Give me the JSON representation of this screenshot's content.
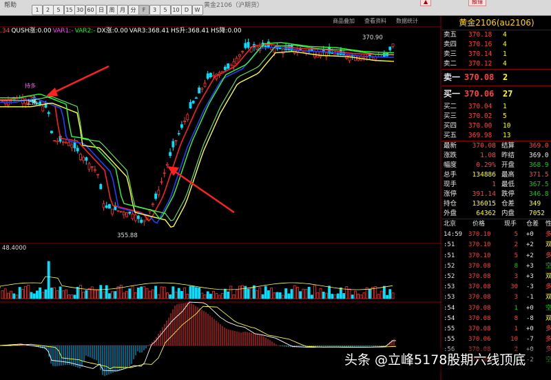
{
  "toolbar": {
    "menu_left": "帮助",
    "title_center": "黄金2106（沪期货）",
    "warn_right": "报错",
    "buttons": [
      "1",
      "2",
      "5",
      "15",
      "30",
      "60",
      "日",
      "周",
      "月",
      "分",
      "F",
      "3",
      "5",
      "10",
      "D",
      "W"
    ]
  },
  "chart": {
    "indicator_line": [
      {
        "text": ".34",
        "color": "#ff4040"
      },
      {
        "text": "QUSH涨:0.00",
        "color": "#ffffff"
      },
      {
        "text": "VAR1:-",
        "color": "#ff40ff"
      },
      {
        "text": "VAR2:-",
        "color": "#00ff00"
      },
      {
        "text": "DX涨:0.00",
        "color": "#ffffff"
      },
      {
        "text": "VAR3:368.41",
        "color": "#ffffff"
      },
      {
        "text": "HS升:368.41",
        "color": "#ffffff"
      },
      {
        "text": "HS降:0.00",
        "color": "#ffffff"
      }
    ],
    "ribbon_labels": [
      "商品叠加",
      "查看资料",
      "数据统计"
    ],
    "high_label": "370.90",
    "low_label": "355.88",
    "signal_up": "上扬",
    "signal_note": "持多",
    "volume_label": "48.4000",
    "chart_data": {
      "type": "candlestick",
      "high": 370.9,
      "low": 355.88,
      "volume_max": 48.4
    }
  },
  "quote": {
    "title": "黄金2106(au2106)",
    "asks": [
      {
        "label": "卖五",
        "price": "370.18",
        "vol": "4"
      },
      {
        "label": "卖四",
        "price": "370.16",
        "vol": "4"
      },
      {
        "label": "卖三",
        "price": "370.14",
        "vol": "1"
      },
      {
        "label": "卖二",
        "price": "370.12",
        "vol": "4"
      }
    ],
    "ask1": {
      "label": "卖一",
      "price": "370.08",
      "vol": "2"
    },
    "bid1": {
      "label": "买一",
      "price": "370.06",
      "vol": "27"
    },
    "bids": [
      {
        "label": "买二",
        "price": "370.04",
        "vol": "1"
      },
      {
        "label": "买三",
        "price": "370.02",
        "vol": "5"
      },
      {
        "label": "买四",
        "price": "370.00",
        "vol": "10"
      },
      {
        "label": "买五",
        "price": "369.98",
        "vol": "13"
      }
    ],
    "stats": [
      {
        "l1": "最新",
        "v1": "370.08",
        "l2": "结算",
        "v2": "369.0"
      },
      {
        "l1": "涨跌",
        "v1": "1.08",
        "l2": "昨结",
        "v2": "369.0"
      },
      {
        "l1": "幅度",
        "v1": "0.29%",
        "l2": "开盘",
        "v2": "368.9"
      },
      {
        "l1": "总手",
        "v1": "134886",
        "l2": "最高",
        "v2": "371.5"
      },
      {
        "l1": "现手",
        "v1": "1",
        "l2": "最低",
        "v2": "367.5"
      },
      {
        "l1": "涨停",
        "v1": "391.14",
        "l2": "跌停",
        "v2": "346.8"
      },
      {
        "l1": "持仓",
        "v1": "136015",
        "l2": "仓差",
        "v2": "349"
      },
      {
        "l1": "外盘",
        "v1": "64362",
        "l2": "内盘",
        "v2": "7052"
      }
    ],
    "tick_header": {
      "time": "北京",
      "price": "价格",
      "vol": "现手",
      "oi": "仓差",
      "kind": "性"
    },
    "ticks": [
      {
        "time": "14:59",
        "price": "370.10",
        "vol": "5",
        "oi": "+0",
        "kind": "多"
      },
      {
        "time": ":51",
        "price": "370.10",
        "vol": "2",
        "oi": "+2",
        "kind": "双"
      },
      {
        "time": ":51",
        "price": "370.10",
        "vol": "5",
        "oi": "+2",
        "kind": "多"
      },
      {
        "time": ":52",
        "price": "370.08",
        "vol": "8",
        "oi": "+3",
        "kind": "空"
      },
      {
        "time": ":52",
        "price": "370.08",
        "vol": "3",
        "oi": "+3",
        "kind": "双"
      },
      {
        "time": ":53",
        "price": "370.08",
        "vol": "30",
        "oi": "-3",
        "kind": "多"
      },
      {
        "time": ":53",
        "price": "370.08",
        "vol": "3",
        "oi": "-1",
        "kind": "双"
      },
      {
        "time": ":54",
        "price": "370.08",
        "vol": "1",
        "oi": "+0",
        "kind": "空"
      },
      {
        "time": ":54",
        "price": "370.08",
        "vol": "8",
        "oi": "-8",
        "kind": "双"
      },
      {
        "time": ":55",
        "price": "370.08",
        "vol": "1",
        "oi": "+0",
        "kind": "多"
      },
      {
        "time": ":55",
        "price": "370.06",
        "vol": "10",
        "oi": "-7",
        "kind": "多"
      },
      {
        "time": ":56",
        "price": "370.08",
        "vol": "2",
        "oi": "+0",
        "kind": "多"
      },
      {
        "time": ":57",
        "price": "370.08",
        "vol": "3",
        "oi": "-2",
        "kind": "空"
      }
    ]
  },
  "watermark": "头条 @立峰5178股期六线顶底"
}
